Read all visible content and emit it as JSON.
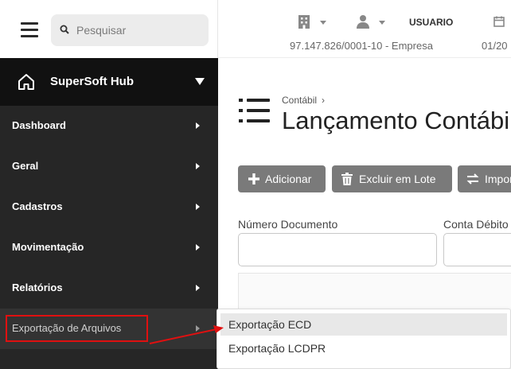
{
  "sidebar": {
    "search_placeholder": "Pesquisar",
    "hub_title": "SuperSoft Hub",
    "items": [
      {
        "label": "Dashboard"
      },
      {
        "label": "Geral"
      },
      {
        "label": "Cadastros"
      },
      {
        "label": "Movimentação"
      },
      {
        "label": "Relatórios"
      },
      {
        "label": "Exportação de Arquivos"
      }
    ]
  },
  "header": {
    "user_label": "USUARIO",
    "company": "97.147.826/0001-10 - Empresa",
    "date_partial": "01/20"
  },
  "main": {
    "breadcrumb": "Contábil",
    "title": "Lançamento Contábil",
    "buttons": {
      "add": "Adicionar",
      "bulk_delete": "Excluir em Lote",
      "import": "Importar"
    },
    "filters": {
      "document_number_label": "Número Documento",
      "debit_account_label": "Conta Débito"
    }
  },
  "submenu": {
    "items": [
      {
        "label": "Exportação ECD"
      },
      {
        "label": "Exportação LCDPR"
      }
    ]
  },
  "colors": {
    "sidebar_bg": "#262626",
    "hub_bg": "#111111",
    "button_bg": "#7a7a7a",
    "annotation_red": "#e01010"
  },
  "icons": [
    "menu-icon",
    "search-icon",
    "home-icon",
    "building-icon",
    "user-icon",
    "calendar-icon",
    "list-icon",
    "plus-icon",
    "trash-icon",
    "swap-icon"
  ]
}
